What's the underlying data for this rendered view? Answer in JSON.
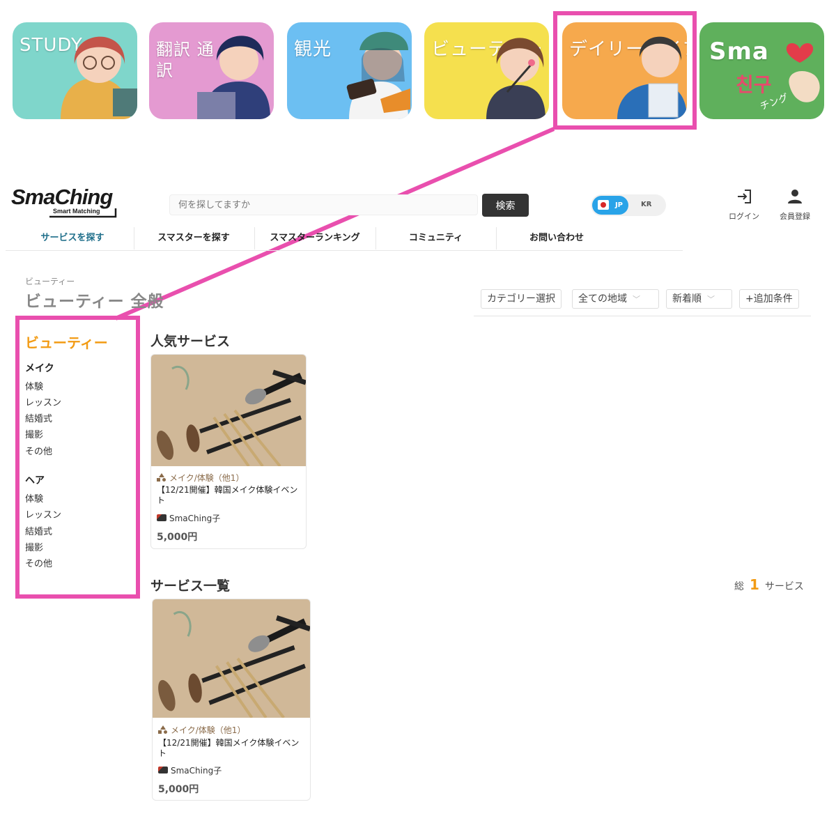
{
  "tiles": [
    {
      "label": "STUDY",
      "color": "#7fd6cb"
    },
    {
      "label": "翻訳 通訳",
      "color": "#e49ad1"
    },
    {
      "label": "観光",
      "color": "#6cbff2"
    },
    {
      "label": "ビューティー",
      "color": "#f5e04e"
    },
    {
      "label": "デイリーライフ",
      "color": "#f6a94d"
    },
    {
      "label": "Sma",
      "sub1": "친구",
      "sub2": "チング",
      "color": "#5fb05c"
    }
  ],
  "highlight_color": "#e94fae",
  "header": {
    "logo": "SmaChing",
    "logo_sub": "Smart Matching",
    "search_placeholder": "何を探してますか",
    "search_button": "検索",
    "lang_jp": "JP",
    "lang_kr": "KR",
    "login": "ログイン",
    "register": "会員登録"
  },
  "nav": [
    "サービスを探す",
    "スマスターを探す",
    "スマスターランキング",
    "コミュニティ",
    "お問い合わせ"
  ],
  "breadcrumb": "ビューティー",
  "page_title": "ビューティー 全般",
  "filters": {
    "category": "カテゴリー選択",
    "region": "全ての地域",
    "sort": "新着順",
    "more": "+追加条件"
  },
  "sidebar": {
    "title": "ビューティー",
    "groups": [
      {
        "name": "メイク",
        "links": [
          "体験",
          "レッスン",
          "結婚式",
          "撮影",
          "その他"
        ]
      },
      {
        "name": "ヘア",
        "links": [
          "体験",
          "レッスン",
          "結婚式",
          "撮影",
          "その他"
        ]
      }
    ]
  },
  "popular": {
    "title": "人気サービス",
    "card": {
      "category": "メイク/体験（他1）",
      "title": "【12/21開催】韓国メイク体験イベント",
      "author": "SmaChing子",
      "price": "5,000円"
    }
  },
  "list": {
    "title": "サービス一覧",
    "total_prefix": "総",
    "total_count": "1",
    "total_suffix": "サービス",
    "card": {
      "category": "メイク/体験（他1）",
      "title": "【12/21開催】韓国メイク体験イベント",
      "author": "SmaChing子",
      "price": "5,000円"
    }
  }
}
